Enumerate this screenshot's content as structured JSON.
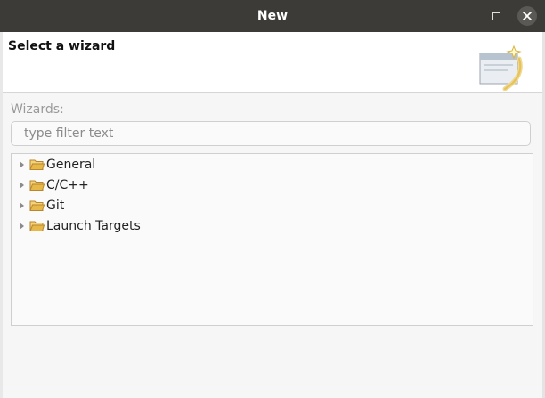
{
  "window": {
    "title": "New"
  },
  "header": {
    "title": "Select a wizard",
    "banner_icon": "new-wizard-icon"
  },
  "filter": {
    "label": "Wizards:",
    "placeholder": "type filter text",
    "value": ""
  },
  "tree": {
    "items": [
      {
        "label": "General",
        "icon": "folder-icon",
        "expanded": false
      },
      {
        "label": "C/C++",
        "icon": "folder-icon",
        "expanded": false
      },
      {
        "label": "Git",
        "icon": "folder-icon",
        "expanded": false
      },
      {
        "label": "Launch Targets",
        "icon": "folder-icon",
        "expanded": false
      }
    ]
  },
  "colors": {
    "titlebar": "#3c3b37",
    "folder": "#e0b44a",
    "folder_dark": "#b8862c"
  }
}
